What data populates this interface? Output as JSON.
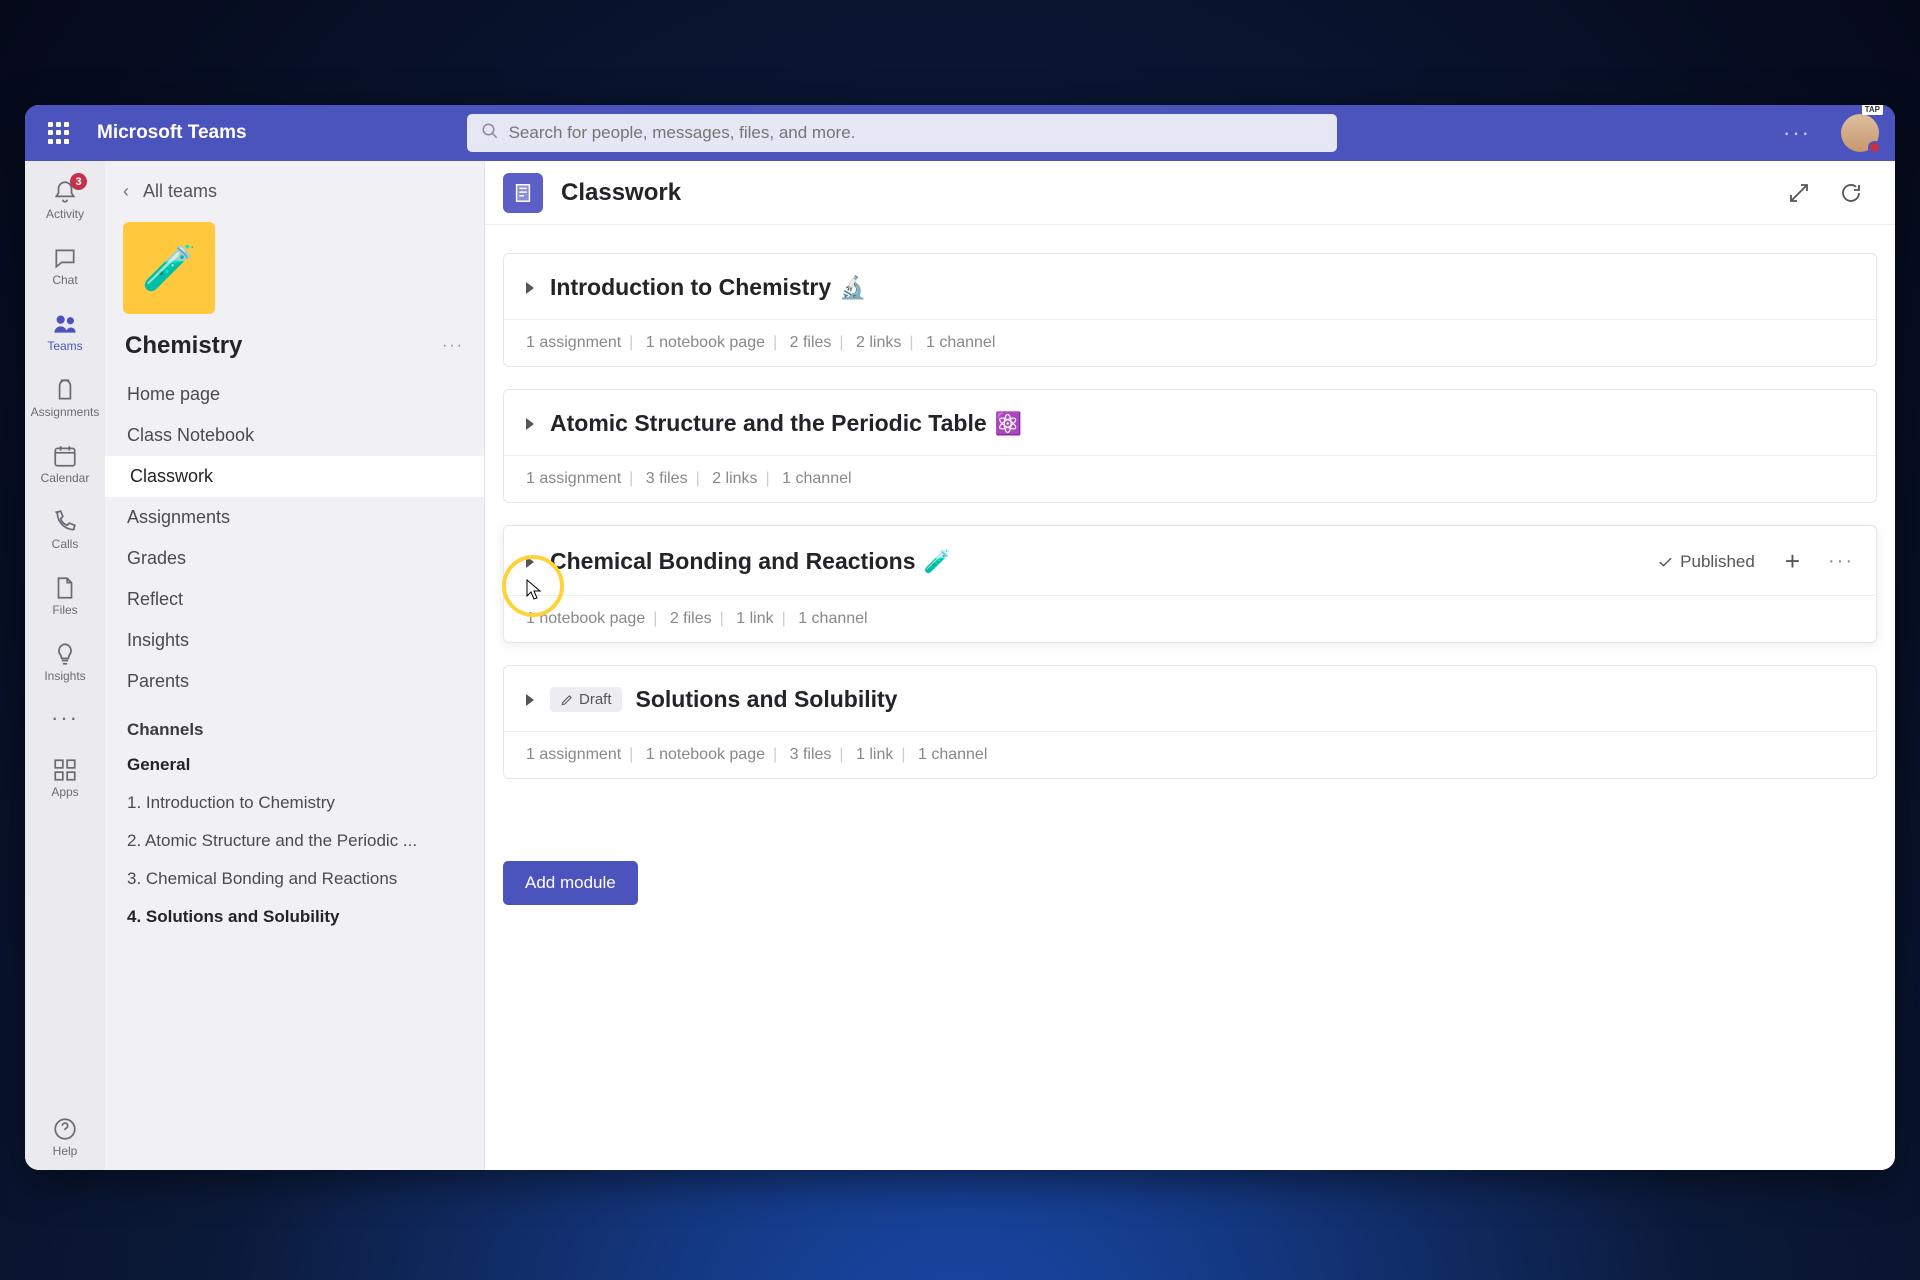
{
  "topbar": {
    "brand": "Microsoft Teams",
    "search_placeholder": "Search for people, messages, files, and more.",
    "avatar_badge": "TAP"
  },
  "rail": {
    "items": [
      {
        "label": "Activity",
        "badge": "3"
      },
      {
        "label": "Chat"
      },
      {
        "label": "Teams"
      },
      {
        "label": "Assignments"
      },
      {
        "label": "Calendar"
      },
      {
        "label": "Calls"
      },
      {
        "label": "Files"
      },
      {
        "label": "Insights"
      }
    ],
    "apps": "Apps",
    "help": "Help"
  },
  "sidebar": {
    "back": "All teams",
    "team": "Chemistry",
    "links": [
      "Home page",
      "Class Notebook",
      "Classwork",
      "Assignments",
      "Grades",
      "Reflect",
      "Insights",
      "Parents"
    ],
    "channels_header": "Channels",
    "channels": [
      "General",
      "1. Introduction to Chemistry",
      "2. Atomic Structure and the Periodic ...",
      "3. Chemical Bonding and Reactions",
      "4. Solutions and Solubility"
    ]
  },
  "main": {
    "title": "Classwork",
    "add_button": "Add module",
    "published_label": "Published",
    "draft_label": "Draft",
    "modules": [
      {
        "title": "Introduction to Chemistry",
        "emoji": "🔬",
        "meta": [
          "1 assignment",
          "1 notebook page",
          "2 files",
          "2 links",
          "1 channel"
        ]
      },
      {
        "title": "Atomic Structure and the Periodic Table",
        "emoji": "⚛️",
        "meta": [
          "1 assignment",
          "3 files",
          "2 links",
          "1 channel"
        ]
      },
      {
        "title": "Chemical Bonding and Reactions",
        "emoji": "🧪",
        "meta": [
          "1 notebook page",
          "2 files",
          "1 link",
          "1 channel"
        ]
      },
      {
        "title": "Solutions and Solubility",
        "meta": [
          "1 assignment",
          "1 notebook page",
          "3 files",
          "1 link",
          "1 channel"
        ]
      }
    ]
  }
}
